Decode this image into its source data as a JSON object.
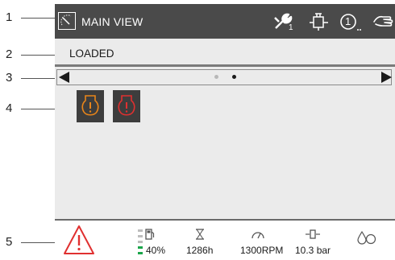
{
  "callouts": [
    "1",
    "2",
    "3",
    "4",
    "5"
  ],
  "header": {
    "title": "MAIN VIEW",
    "service_badge": "1",
    "counter_label": "1",
    "icons": [
      "view-icon",
      "service-wrench-icon",
      "engine-icon",
      "info-counter-icon",
      "manual-hand-icon"
    ]
  },
  "status": {
    "text": "LOADED"
  },
  "pager": {
    "page_count": 2,
    "active_page": 2
  },
  "alarms": [
    {
      "icon": "warning-amber-icon",
      "color": "#e8851a"
    },
    {
      "icon": "shutdown-red-icon",
      "color": "#e03030"
    }
  ],
  "footer": {
    "alarm_icon": "warning-triangle-icon",
    "fuel_level": "40%",
    "fuel_fraction": 0.4,
    "running_hours": "1286h",
    "engine_speed": "1300RPM",
    "pressure": "10.3 bar"
  },
  "colors": {
    "header_bg": "#4a4a4a",
    "screen_bg": "#ebebeb",
    "amber": "#e8851a",
    "red": "#e03030",
    "fuel_green": "#1aa64a"
  }
}
